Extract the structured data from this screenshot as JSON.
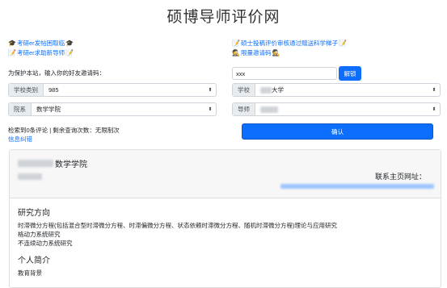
{
  "header": {
    "title": "硕博导师评价网"
  },
  "links": {
    "forum_post": "考研er发帖困取临",
    "help_guide": "考研er求助新导师",
    "appeal": "硕士投稿评价审核通过赠送科学梯子",
    "invite_code": "限量邀请码"
  },
  "invite": {
    "prompt": "为保护本站，输入你的好友邀请码：",
    "value": "xxx",
    "unlock_label": "解锁"
  },
  "filters": {
    "category_label": "学校类别",
    "category_value": "985",
    "school_label": "学校",
    "school_value_suffix": "大学",
    "dept_label": "院系",
    "dept_value": "数学学院",
    "mentor_label": "导师"
  },
  "confirm_label": "确认",
  "stats": {
    "text": "检索到0条评论 | 剩余查询次数：无限制次",
    "error_link": "信息纠错"
  },
  "profile": {
    "dept": "数学学院",
    "homepage_label": "联系主页网址：",
    "research_heading": "研究方向",
    "research_lines": [
      "时滞微分方程(包括混合型时滞微分方程、时滞偏微分方程、状态依赖时滞微分方程、随机时滞微分方程)理论与应用研究",
      "格动力系统研究",
      "不连续动力系统研究"
    ],
    "bio_heading": "个人简介",
    "education_label": "教育背景"
  },
  "colors": {
    "accent": "#0d6efd",
    "link": "#0d6efd"
  }
}
